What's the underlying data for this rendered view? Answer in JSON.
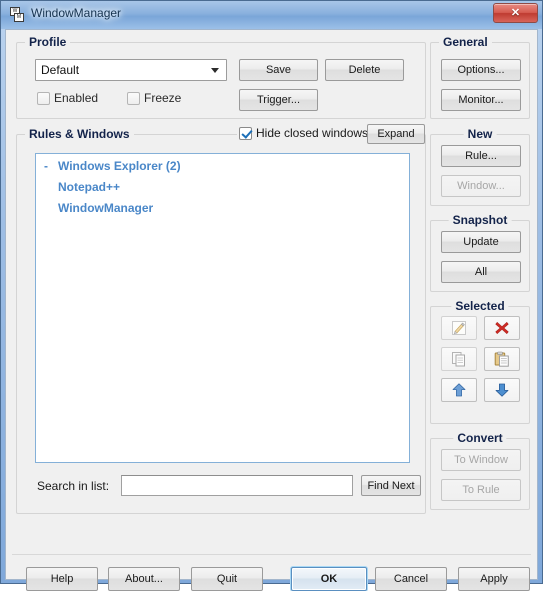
{
  "window": {
    "title": "WindowManager",
    "icon": "windowmanager-icon",
    "close_label": "✕",
    "accent_blue": "#4a87c8",
    "titlebar_blue": "#89b0dd",
    "close_red": "#c0392b"
  },
  "profile": {
    "group_label": "Profile",
    "combo_value": "Default",
    "combo_options": [
      "Default"
    ],
    "save_label": "Save",
    "delete_label": "Delete",
    "trigger_label": "Trigger...",
    "enabled_label": "Enabled",
    "enabled_checked": false,
    "freeze_label": "Freeze",
    "freeze_checked": false
  },
  "general": {
    "group_label": "General",
    "options_label": "Options...",
    "monitor_label": "Monitor..."
  },
  "rules": {
    "group_label": "Rules & Windows",
    "hide_closed_label": "Hide closed windows",
    "hide_closed_checked": true,
    "expand_label": "Expand",
    "tree": [
      {
        "toggle": "-",
        "label": "Windows Explorer (2)",
        "indent": 0
      },
      {
        "toggle": "",
        "label": "Notepad++",
        "indent": 1
      },
      {
        "toggle": "",
        "label": "WindowManager",
        "indent": 1
      }
    ],
    "search_label": "Search in list:",
    "search_value": "",
    "search_placeholder": "",
    "find_next_label": "Find Next"
  },
  "side": {
    "new_label": "New",
    "new_rule_label": "Rule...",
    "new_window_label": "Window...",
    "new_window_disabled": true,
    "snapshot_label": "Snapshot",
    "snapshot_update_label": "Update",
    "snapshot_all_label": "All",
    "selected_label": "Selected",
    "selected_icons": [
      {
        "name": "edit-icon",
        "disabled": true
      },
      {
        "name": "delete-icon",
        "disabled": false
      },
      {
        "name": "copy-icon",
        "disabled": true
      },
      {
        "name": "paste-icon",
        "disabled": false
      },
      {
        "name": "move-up-icon",
        "disabled": false
      },
      {
        "name": "move-down-icon",
        "disabled": false
      }
    ],
    "convert_label": "Convert",
    "to_window_label": "To Window",
    "to_window_disabled": true,
    "to_rule_label": "To Rule",
    "to_rule_disabled": true
  },
  "footer": {
    "help_label": "Help",
    "about_label": "About...",
    "quit_label": "Quit",
    "ok_label": "OK",
    "cancel_label": "Cancel",
    "apply_label": "Apply"
  }
}
